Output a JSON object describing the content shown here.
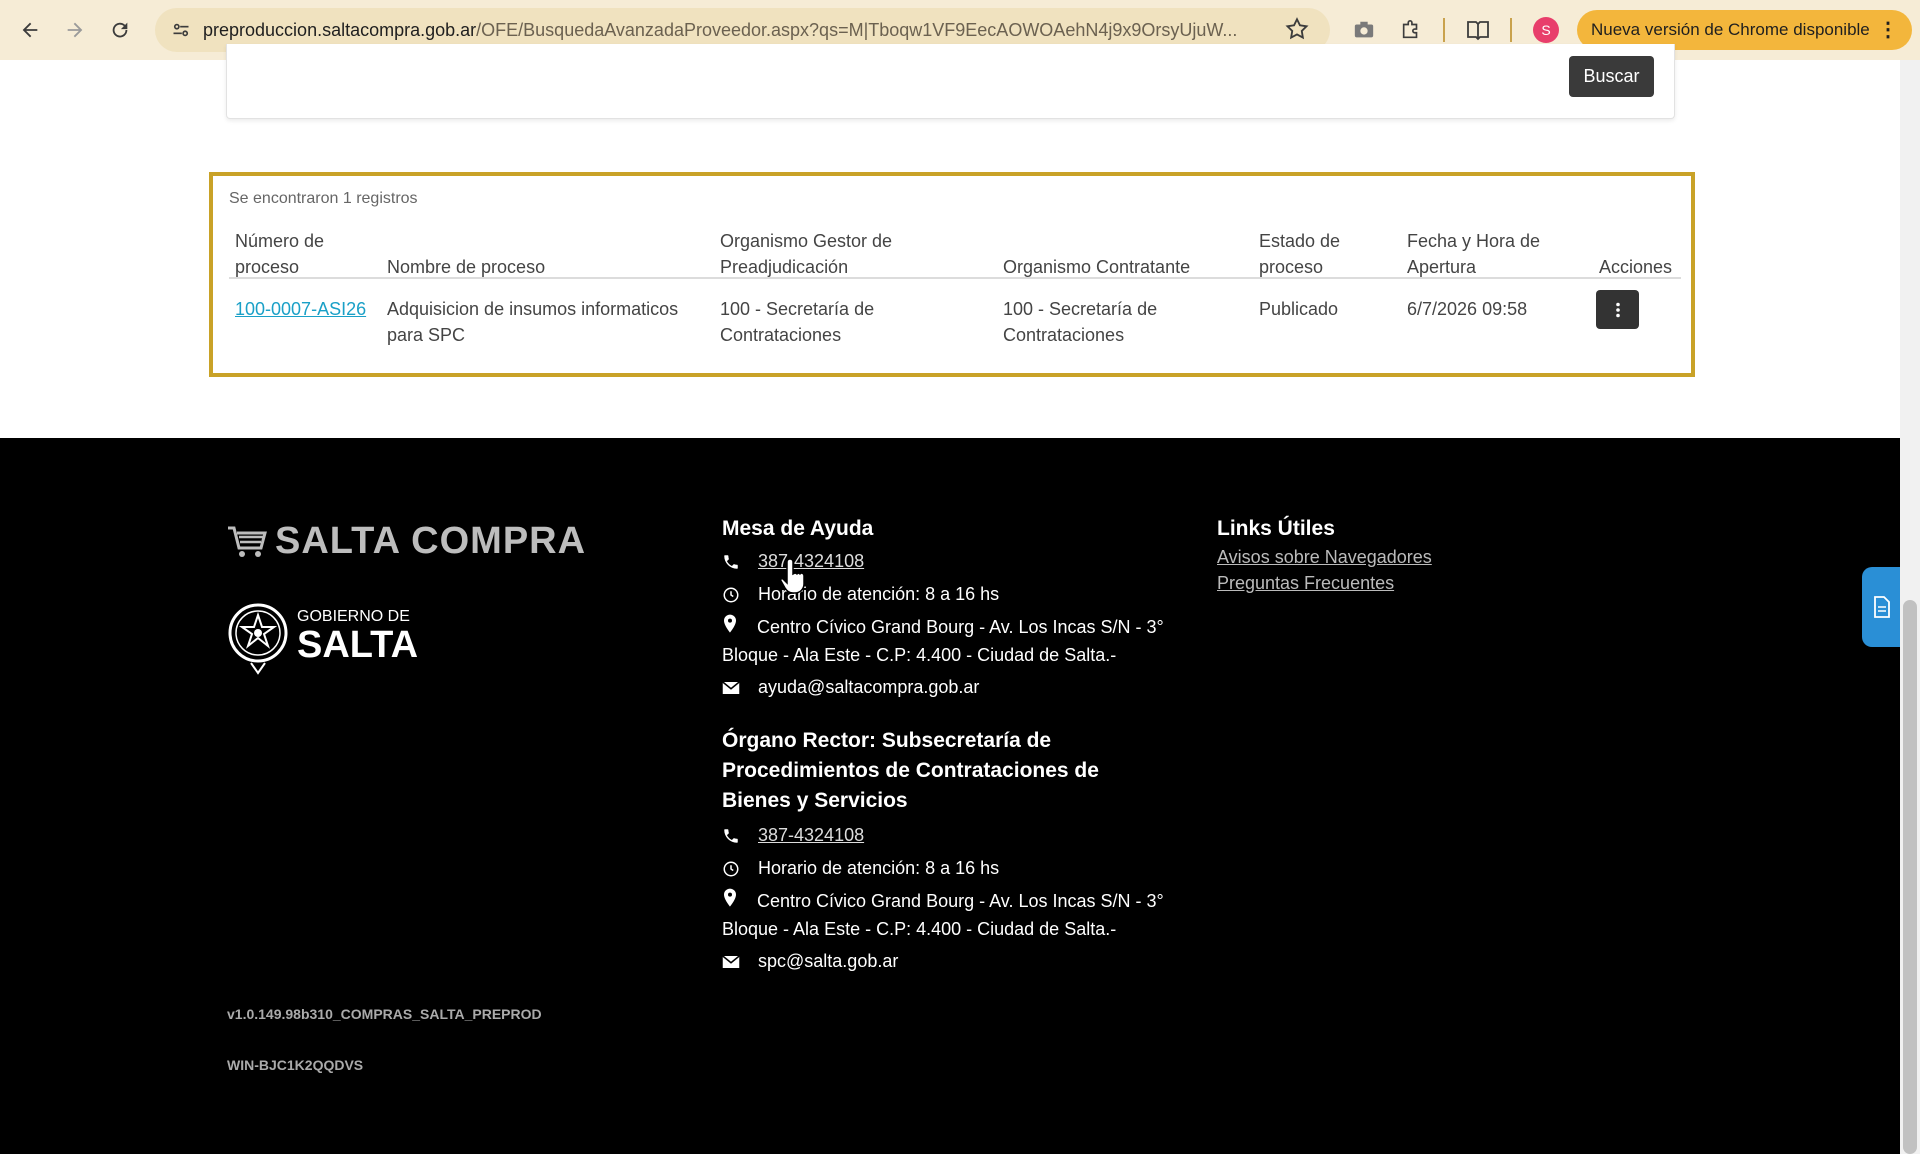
{
  "browser": {
    "url_host": "preproduccion.saltacompra.gob.ar",
    "url_path": "/OFE/BusquedaAvanzadaProveedor.aspx?qs=M|Tboqw1VF9EecAOWOAehN4j9x9OrsyUjuW...",
    "profile_initial": "S",
    "update_label": "Nueva versión de Chrome disponible"
  },
  "search": {
    "button_label": "Buscar"
  },
  "results": {
    "count_text": "Se encontraron 1 registros",
    "headers": {
      "numero": "Número de proceso",
      "nombre": "Nombre de proceso",
      "gestor": "Organismo Gestor de Preadjudicación",
      "contratante": "Organismo Contratante",
      "estado": "Estado de proceso",
      "fecha": "Fecha y Hora de Apertura",
      "acciones": "Acciones"
    },
    "rows": [
      {
        "numero": "100-0007-ASI26",
        "nombre": "Adquisicion de insumos informaticos para SPC",
        "gestor": "100 - Secretaría de Contrataciones",
        "contratante": "100 - Secretaría de Contrataciones",
        "estado": "Publicado",
        "fecha": "6/7/2026 09:58"
      }
    ]
  },
  "footer": {
    "logo_text": "SALTA COMPRA",
    "gob_small": "GOBIERNO DE",
    "gob_big": "SALTA",
    "mesa": {
      "title": "Mesa de Ayuda",
      "phone": "387-4324108",
      "hours": "Horario de atención: 8 a 16 hs",
      "address": "Centro Cívico Grand Bourg - Av. Los Incas S/N - 3° Bloque - Ala Este - C.P: 4.400 - Ciudad de Salta.-",
      "email": "ayuda@saltacompra.gob.ar"
    },
    "organo": {
      "title": "Órgano Rector: Subsecretaría de Procedimientos de Contrataciones de Bienes y Servicios",
      "phone": "387-4324108",
      "hours": "Horario de atención: 8 a 16 hs",
      "address": "Centro Cívico Grand Bourg - Av. Los Incas S/N - 3° Bloque - Ala Este - C.P: 4.400 - Ciudad de Salta.-",
      "email": "spc@salta.gob.ar"
    },
    "links": {
      "title": "Links Útiles",
      "items": [
        "Avisos sobre Navegadores",
        "Preguntas Frecuentes"
      ]
    },
    "version": "v1.0.149.98b310_COMPRAS_SALTA_PREPROD",
    "host": "WIN-BJC1K2QQDVS"
  }
}
